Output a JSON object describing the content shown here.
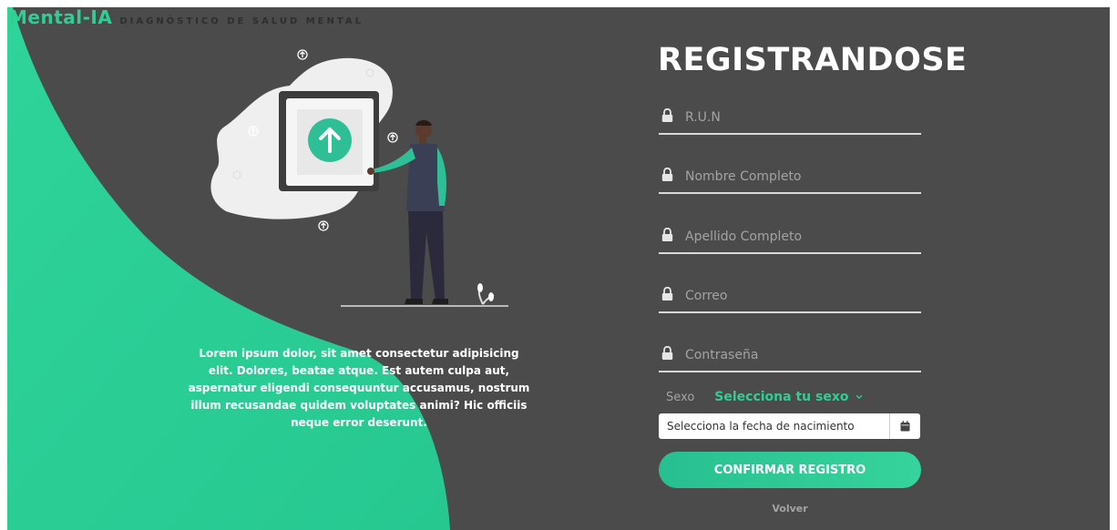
{
  "brand": {
    "name": "Mental-IA",
    "subtitle": "DIAGNÓSTICO DE SALUD MENTAL"
  },
  "intro": {
    "text": "Lorem ipsum dolor, sit amet consectetur adipisicing elit. Dolores, beatae atque. Est autem culpa aut, aspernatur eligendi consequuntur accusamus, nostrum illum recusandae quidem voluptates animi? Hic officiis neque error deserunt."
  },
  "form": {
    "title": "REGISTRANDOSE",
    "fields": [
      {
        "placeholder": "R.U.N",
        "icon": "lock-icon"
      },
      {
        "placeholder": "Nombre Completo",
        "icon": "lock-icon"
      },
      {
        "placeholder": "Apellido Completo",
        "icon": "lock-icon"
      },
      {
        "placeholder": "Correo",
        "icon": "lock-icon"
      },
      {
        "placeholder": "Contraseña",
        "icon": "lock-icon"
      }
    ],
    "sex_label": "Sexo",
    "sex_select": "Selecciona tu sexo",
    "birthdate_placeholder": "Selecciona la fecha de nacimiento",
    "confirm_label": "CONFIRMAR REGISTRO",
    "back_label": "Volver"
  },
  "colors": {
    "accent": "#2fcf94",
    "background": "#4b4b4b",
    "muted_text": "#a3a3a3"
  }
}
